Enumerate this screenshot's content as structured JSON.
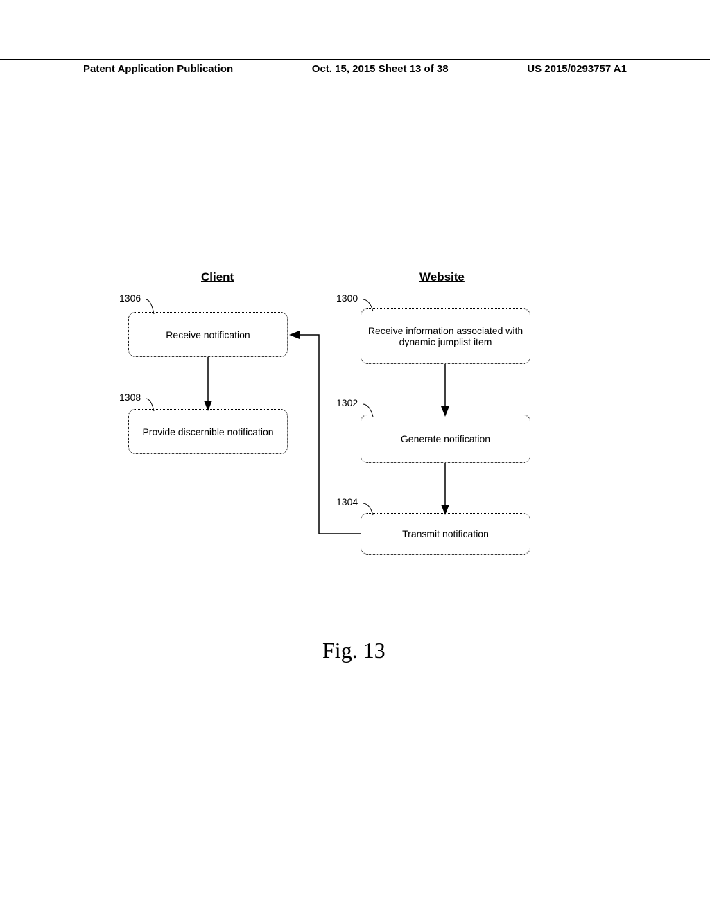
{
  "header": {
    "left": "Patent Application Publication",
    "center": "Oct. 15, 2015  Sheet 13 of 38",
    "right": "US 2015/0293757 A1"
  },
  "columns": {
    "client": "Client",
    "website": "Website"
  },
  "boxes": {
    "b1300": {
      "ref": "1300",
      "text": "Receive information associated with dynamic jumplist item"
    },
    "b1302": {
      "ref": "1302",
      "text": "Generate notification"
    },
    "b1304": {
      "ref": "1304",
      "text": "Transmit notification"
    },
    "b1306": {
      "ref": "1306",
      "text": "Receive notification"
    },
    "b1308": {
      "ref": "1308",
      "text": "Provide discernible notification"
    }
  },
  "figure_caption": "Fig. 13"
}
